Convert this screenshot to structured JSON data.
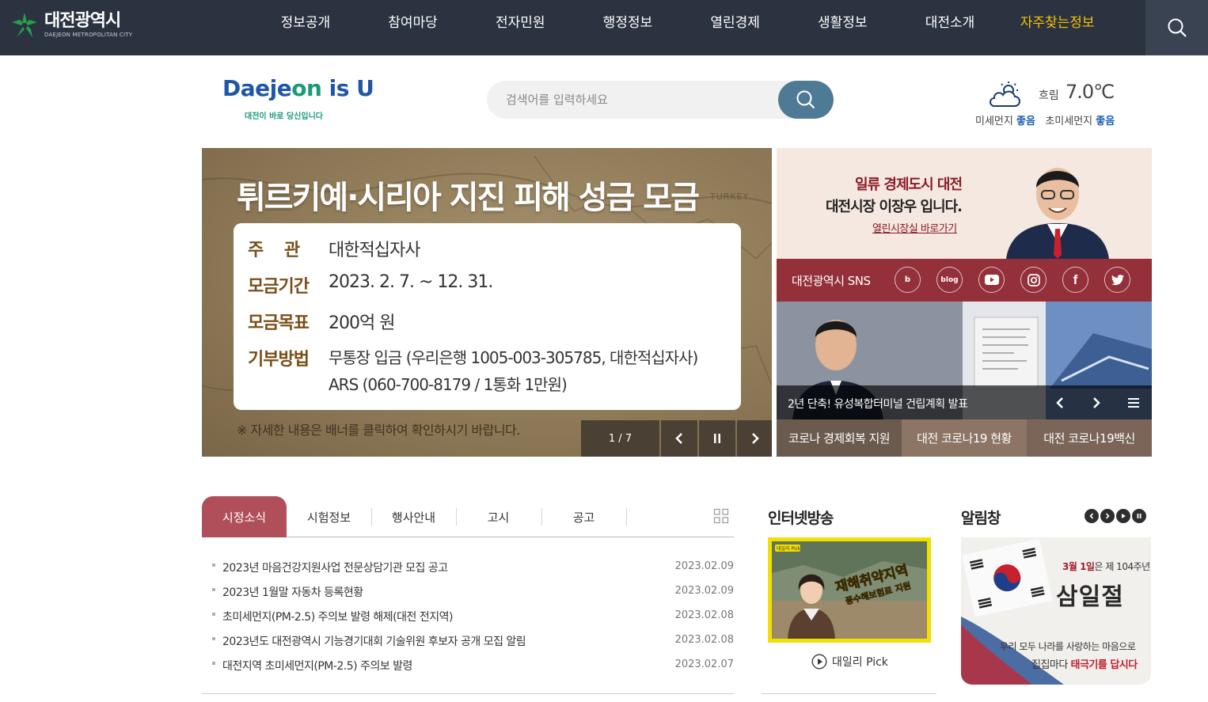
{
  "topbar": {
    "logo": {
      "name_ko": "대전광역시",
      "name_en": "DAEJEON METROPOLITAN CITY"
    },
    "menu": [
      "정보공개",
      "참여마당",
      "전자민원",
      "행정정보",
      "열린경제",
      "생활정보",
      "대전소개",
      "자주찾는정보"
    ],
    "highlight_color": "#f5c400",
    "search_icon": "search-icon"
  },
  "brand": {
    "slogan_prefix": "Daejeon is U",
    "tagline": "대전이 바로 당신입니다"
  },
  "search": {
    "placeholder": "검색어를 입력하세요",
    "button_icon": "search-icon"
  },
  "weather": {
    "icon": "partly-cloudy-icon",
    "condition": "흐림",
    "temp": "7.0℃",
    "pm10_label": "미세먼지",
    "pm10_value": "좋음",
    "pm25_label": "초미세먼지",
    "pm25_value": "좋음"
  },
  "banner": {
    "title": "튀르키예·시리아 지진 피해 성금 모금",
    "map_tag": "TURKEY",
    "rows": [
      {
        "key": "주    관",
        "value": "대한적십자사"
      },
      {
        "key": "모금기간",
        "value": "2023. 2. 7. ~ 12. 31."
      },
      {
        "key": "모금목표",
        "value": "200억 원"
      },
      {
        "key": "기부방법",
        "value": "무통장 입금 (우리은행 1005-003-305785, 대한적십자사)",
        "value2": "ARS (060-700-8179 / 1통화 1만원)"
      }
    ],
    "note": "※ 자세한 내용은 배너를 클릭하여 확인하시기 바랍니다.",
    "counter": "1 / 7",
    "accent": "#7a4e18"
  },
  "mayor": {
    "line1": "일류 경제도시 대전",
    "line2": "대전시장 이장우 입니다.",
    "link": "열린시장실 바로가기"
  },
  "sns": {
    "title": "대전광역시 SNS",
    "items": [
      {
        "icon": "b-icon",
        "label": "b"
      },
      {
        "icon": "blog-icon",
        "label": "blog"
      },
      {
        "icon": "youtube-icon",
        "label": ""
      },
      {
        "icon": "instagram-icon",
        "label": ""
      },
      {
        "icon": "facebook-icon",
        "label": "f"
      },
      {
        "icon": "twitter-icon",
        "label": ""
      }
    ],
    "color": "#94303a"
  },
  "news": {
    "caption": "2년 단축! 유성복합터미널 건립계획 발표"
  },
  "quick_links": [
    {
      "label": "코로나 경제회복 지원",
      "color": "#6b5a4e"
    },
    {
      "label": "대전 코로나19 현황",
      "color": "#8c7565"
    },
    {
      "label": "대전 코로나19백신",
      "color": "#7a6558"
    }
  ],
  "notice": {
    "tabs": [
      "시정소식",
      "시험정보",
      "행사안내",
      "고시",
      "공고"
    ],
    "active_tab": 0,
    "items": [
      {
        "title": "2023년 마음건강지원사업 전문상담기관 모집 공고",
        "date": "2023.02.09"
      },
      {
        "title": "2023년 1월말 자동차 등록현황",
        "date": "2023.02.09"
      },
      {
        "title": "초미세먼지(PM-2.5) 주의보 발령 해제(대전 전지역)",
        "date": "2023.02.08"
      },
      {
        "title": "2023년도 대전광역시 기능경기대회 기술위원 후보자 공개 모집 알림",
        "date": "2023.02.08"
      },
      {
        "title": "대전지역 초미세먼지(PM-2.5) 주의보 발령",
        "date": "2023.02.07"
      }
    ],
    "tab_color": "#b04f5a"
  },
  "broadcast": {
    "title": "인터넷방송",
    "thumb_tag": "대일리 Pick",
    "thumb_text1": "재해취약지역",
    "thumb_text2": "풍수해보험료 지원",
    "caption": "대일리 Pick"
  },
  "alarm": {
    "title": "알림창",
    "line1_prefix": "3월 1일",
    "line1_suffix": "은 제 104주년",
    "big": "삼일절",
    "line3": "우리 모두 나라를 사랑하는 마음으로",
    "line4_prefix": "집집마다 ",
    "line4_em": "태극기를 답시다"
  }
}
